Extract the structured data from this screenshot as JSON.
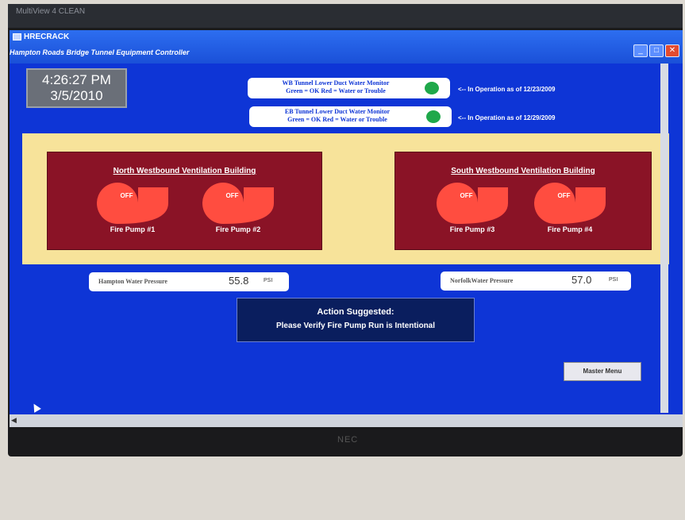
{
  "window": {
    "app_name": "HRECRACK",
    "subtitle": "Hampton Roads Bridge Tunnel Equipment Controller",
    "bezel_text": "MultiView 4 CLEAN"
  },
  "clock": {
    "time": "4:26:27 PM",
    "date": "3/5/2010"
  },
  "monitors": [
    {
      "line1": "WB Tunnel Lower Duct Water Monitor",
      "line2": "Green = OK  Red = Water or Trouble",
      "status_color": "#1fa84a",
      "note": "<-- In Operation as of 12/23/2009"
    },
    {
      "line1": "EB Tunnel Lower Duct Water Monitor",
      "line2": "Green = OK  Red = Water or Trouble",
      "status_color": "#1fa84a",
      "note": "<-- In Operation as of 12/29/2009"
    }
  ],
  "buildings": {
    "north": {
      "name": "North Westbound Ventilation Building",
      "pumps": [
        {
          "state": "OFF",
          "label": "Fire Pump #1"
        },
        {
          "state": "OFF",
          "label": "Fire Pump #2"
        }
      ]
    },
    "south": {
      "name": "South Westbound Ventilation Building",
      "pumps": [
        {
          "state": "OFF",
          "label": "Fire Pump #3"
        },
        {
          "state": "OFF",
          "label": "Fire Pump #4"
        }
      ]
    }
  },
  "pressure": {
    "hampton": {
      "label": "Hampton Water Pressure",
      "value": "55.8",
      "unit": "PSI"
    },
    "norfolk": {
      "label": "NorfolkWater Pressure",
      "value": "57.0",
      "unit": "PSI"
    }
  },
  "action": {
    "heading": "Action Suggested:",
    "message": "Please Verify Fire Pump Run is Intentional"
  },
  "master_menu_label": "Master Menu",
  "monitor_brand": "NEC",
  "colors": {
    "screen_bg": "#0e35d6",
    "building_bg": "#8a1326",
    "pump_off": "#ff4d40",
    "band": "#f7e39a"
  }
}
